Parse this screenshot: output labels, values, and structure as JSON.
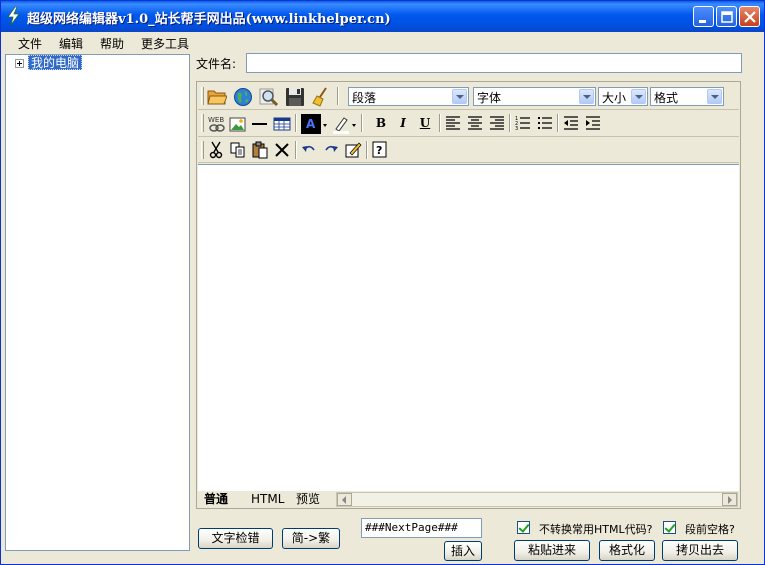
{
  "window": {
    "title": "超级网络编辑器v1.0_站长帮手网出品(www.linkhelper.cn)",
    "icon": "lightning-icon"
  },
  "menu": [
    "文件",
    "编辑",
    "帮助",
    "更多工具"
  ],
  "tree": {
    "root_label": "我的电脑"
  },
  "file": {
    "label": "文件名:",
    "value": ""
  },
  "toolbar": {
    "paragraph": "段落",
    "font": "字体",
    "size": "大小",
    "format": "格式",
    "bold": "B",
    "italic": "I",
    "underline": "U"
  },
  "tabs": [
    "普通",
    "HTML",
    "预览"
  ],
  "bottom": {
    "spellcheck_button": "文字检错",
    "convert_button": "简->繁",
    "nextpage_value": "###NextPage###",
    "insert_button": "插入",
    "option1_label": "不转换常用HTML代码?",
    "option1_checked": true,
    "option2_label": "段前空格?",
    "option2_checked": true,
    "paste_button": "粘贴进来",
    "format_button": "格式化",
    "copy_button": "拷贝出去"
  },
  "colors": {
    "titlebar": "#0058ee",
    "selection": "#316ac5",
    "window_bg": "#ece9d8"
  }
}
